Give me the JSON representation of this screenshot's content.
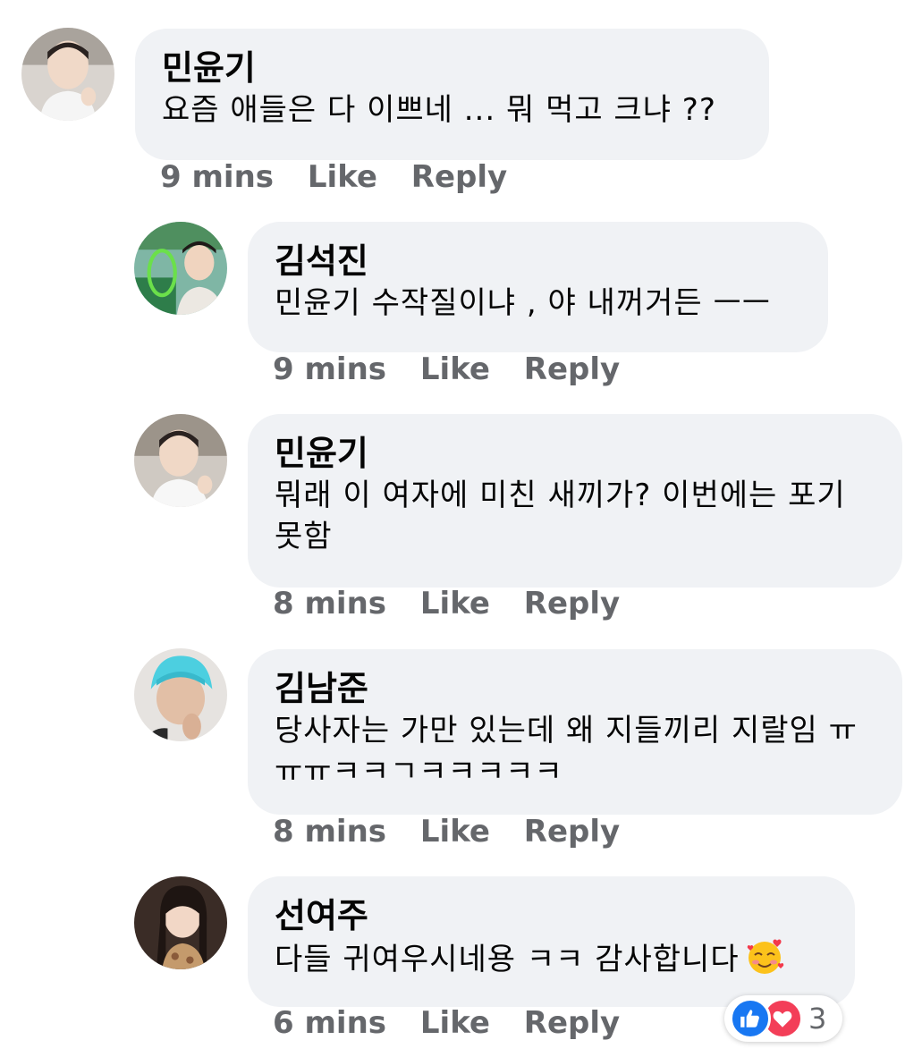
{
  "comments": [
    {
      "author": "민윤기",
      "text": "요즘 애들은 다 이쁘네 ... 뭐 먹고 크냐 ??",
      "time": "9 mins",
      "like": "Like",
      "reply": "Reply"
    },
    {
      "author": "김석진",
      "text": "민윤기 수작질이냐 , 야 내꺼거든 ㅡㅡ",
      "time": "9 mins",
      "like": "Like",
      "reply": "Reply"
    },
    {
      "author": "민윤기",
      "text": "뭐래 이 여자에 미친 새끼가? 이번에는 포기 못함",
      "time": "8 mins",
      "like": "Like",
      "reply": "Reply"
    },
    {
      "author": "김남준",
      "text": "당사자는 가만 있는데 왜 지들끼리 지랄임 ㅠㅠㅠㅋㅋㄱㅋㅋㅋㅋㅋ",
      "time": "8 mins",
      "like": "Like",
      "reply": "Reply"
    },
    {
      "author": "선여주",
      "text": "다들 귀여우시네용 ㅋㅋ 감사합니다",
      "time": "6 mins",
      "like": "Like",
      "reply": "Reply",
      "emoji": "smiling-face-with-hearts",
      "reactions": {
        "icons": [
          "like-icon",
          "love-icon"
        ],
        "count": "3"
      }
    }
  ],
  "colors": {
    "bubble": "#f0f2f5",
    "meta_text": "#65676b",
    "like_blue": "#1877f2",
    "love_red": "#f33e58"
  }
}
